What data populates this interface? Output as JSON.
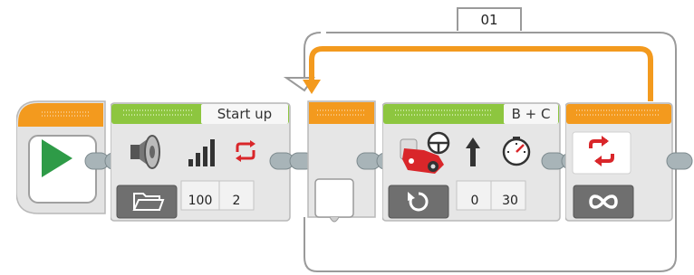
{
  "loop": {
    "counter_label": "01",
    "count_mode_icon": "infinity-icon"
  },
  "start_block": {
    "icon": "play-icon"
  },
  "sound_block": {
    "header_label": "Start up",
    "mode_icon": "folder-icon",
    "param_icons": [
      "speaker-icon",
      "volume-bars-icon",
      "repeat-icon"
    ],
    "volume": "100",
    "play_type": "2"
  },
  "move_block": {
    "header_label": "B + C",
    "mode_icon": "rotate-icon",
    "param_icons": [
      "steering-motor-icon",
      "up-arrow-icon",
      "speedometer-icon"
    ],
    "steering": "0",
    "power": "30"
  },
  "colors": {
    "orange": "#f39a1e",
    "green": "#8dc63f",
    "play_green": "#2e9b47",
    "block_gray": "#e6e6e6",
    "connector": "#a8b4b8"
  }
}
